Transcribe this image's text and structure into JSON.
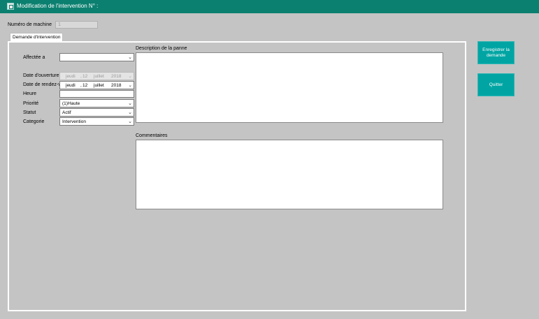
{
  "window": {
    "title": "Modification de l'intervention N° :"
  },
  "machine": {
    "label": "Numéro de machine",
    "value": "1"
  },
  "tab": {
    "label": "Demande d'intervention"
  },
  "form": {
    "affectee_label": "Affectée a",
    "affectee_value": "",
    "date_ouverture_label": "Date d'ouverture",
    "date_ouverture": {
      "day_name": "jeudi",
      "day": "12",
      "month": "juillet",
      "year": "2018"
    },
    "date_rdv_label": "Date de rendez-vo",
    "date_rdv": {
      "day_name": "jeudi",
      "day": "12",
      "month": "juillet",
      "year": "2018"
    },
    "heure_label": "Heure",
    "heure_value": "",
    "priorite_label": "Priorité",
    "priorite_value": "(1)Haute",
    "statut_label": "Statut",
    "statut_value": "Actif",
    "categorie_label": "Categorie",
    "categorie_value": "Intervention"
  },
  "description": {
    "label": "Description de la panne",
    "value": ""
  },
  "commentaires": {
    "label": "Commentaires",
    "value": ""
  },
  "buttons": {
    "save": "Enregistrer la demande",
    "quit": "Quitter"
  },
  "colors": {
    "titlebar": "#0c8070",
    "button": "#00a5a3",
    "background": "#c4c4c4"
  },
  "icons": {
    "app": "app-window-icon",
    "dropdown": "chevron-down-icon"
  }
}
